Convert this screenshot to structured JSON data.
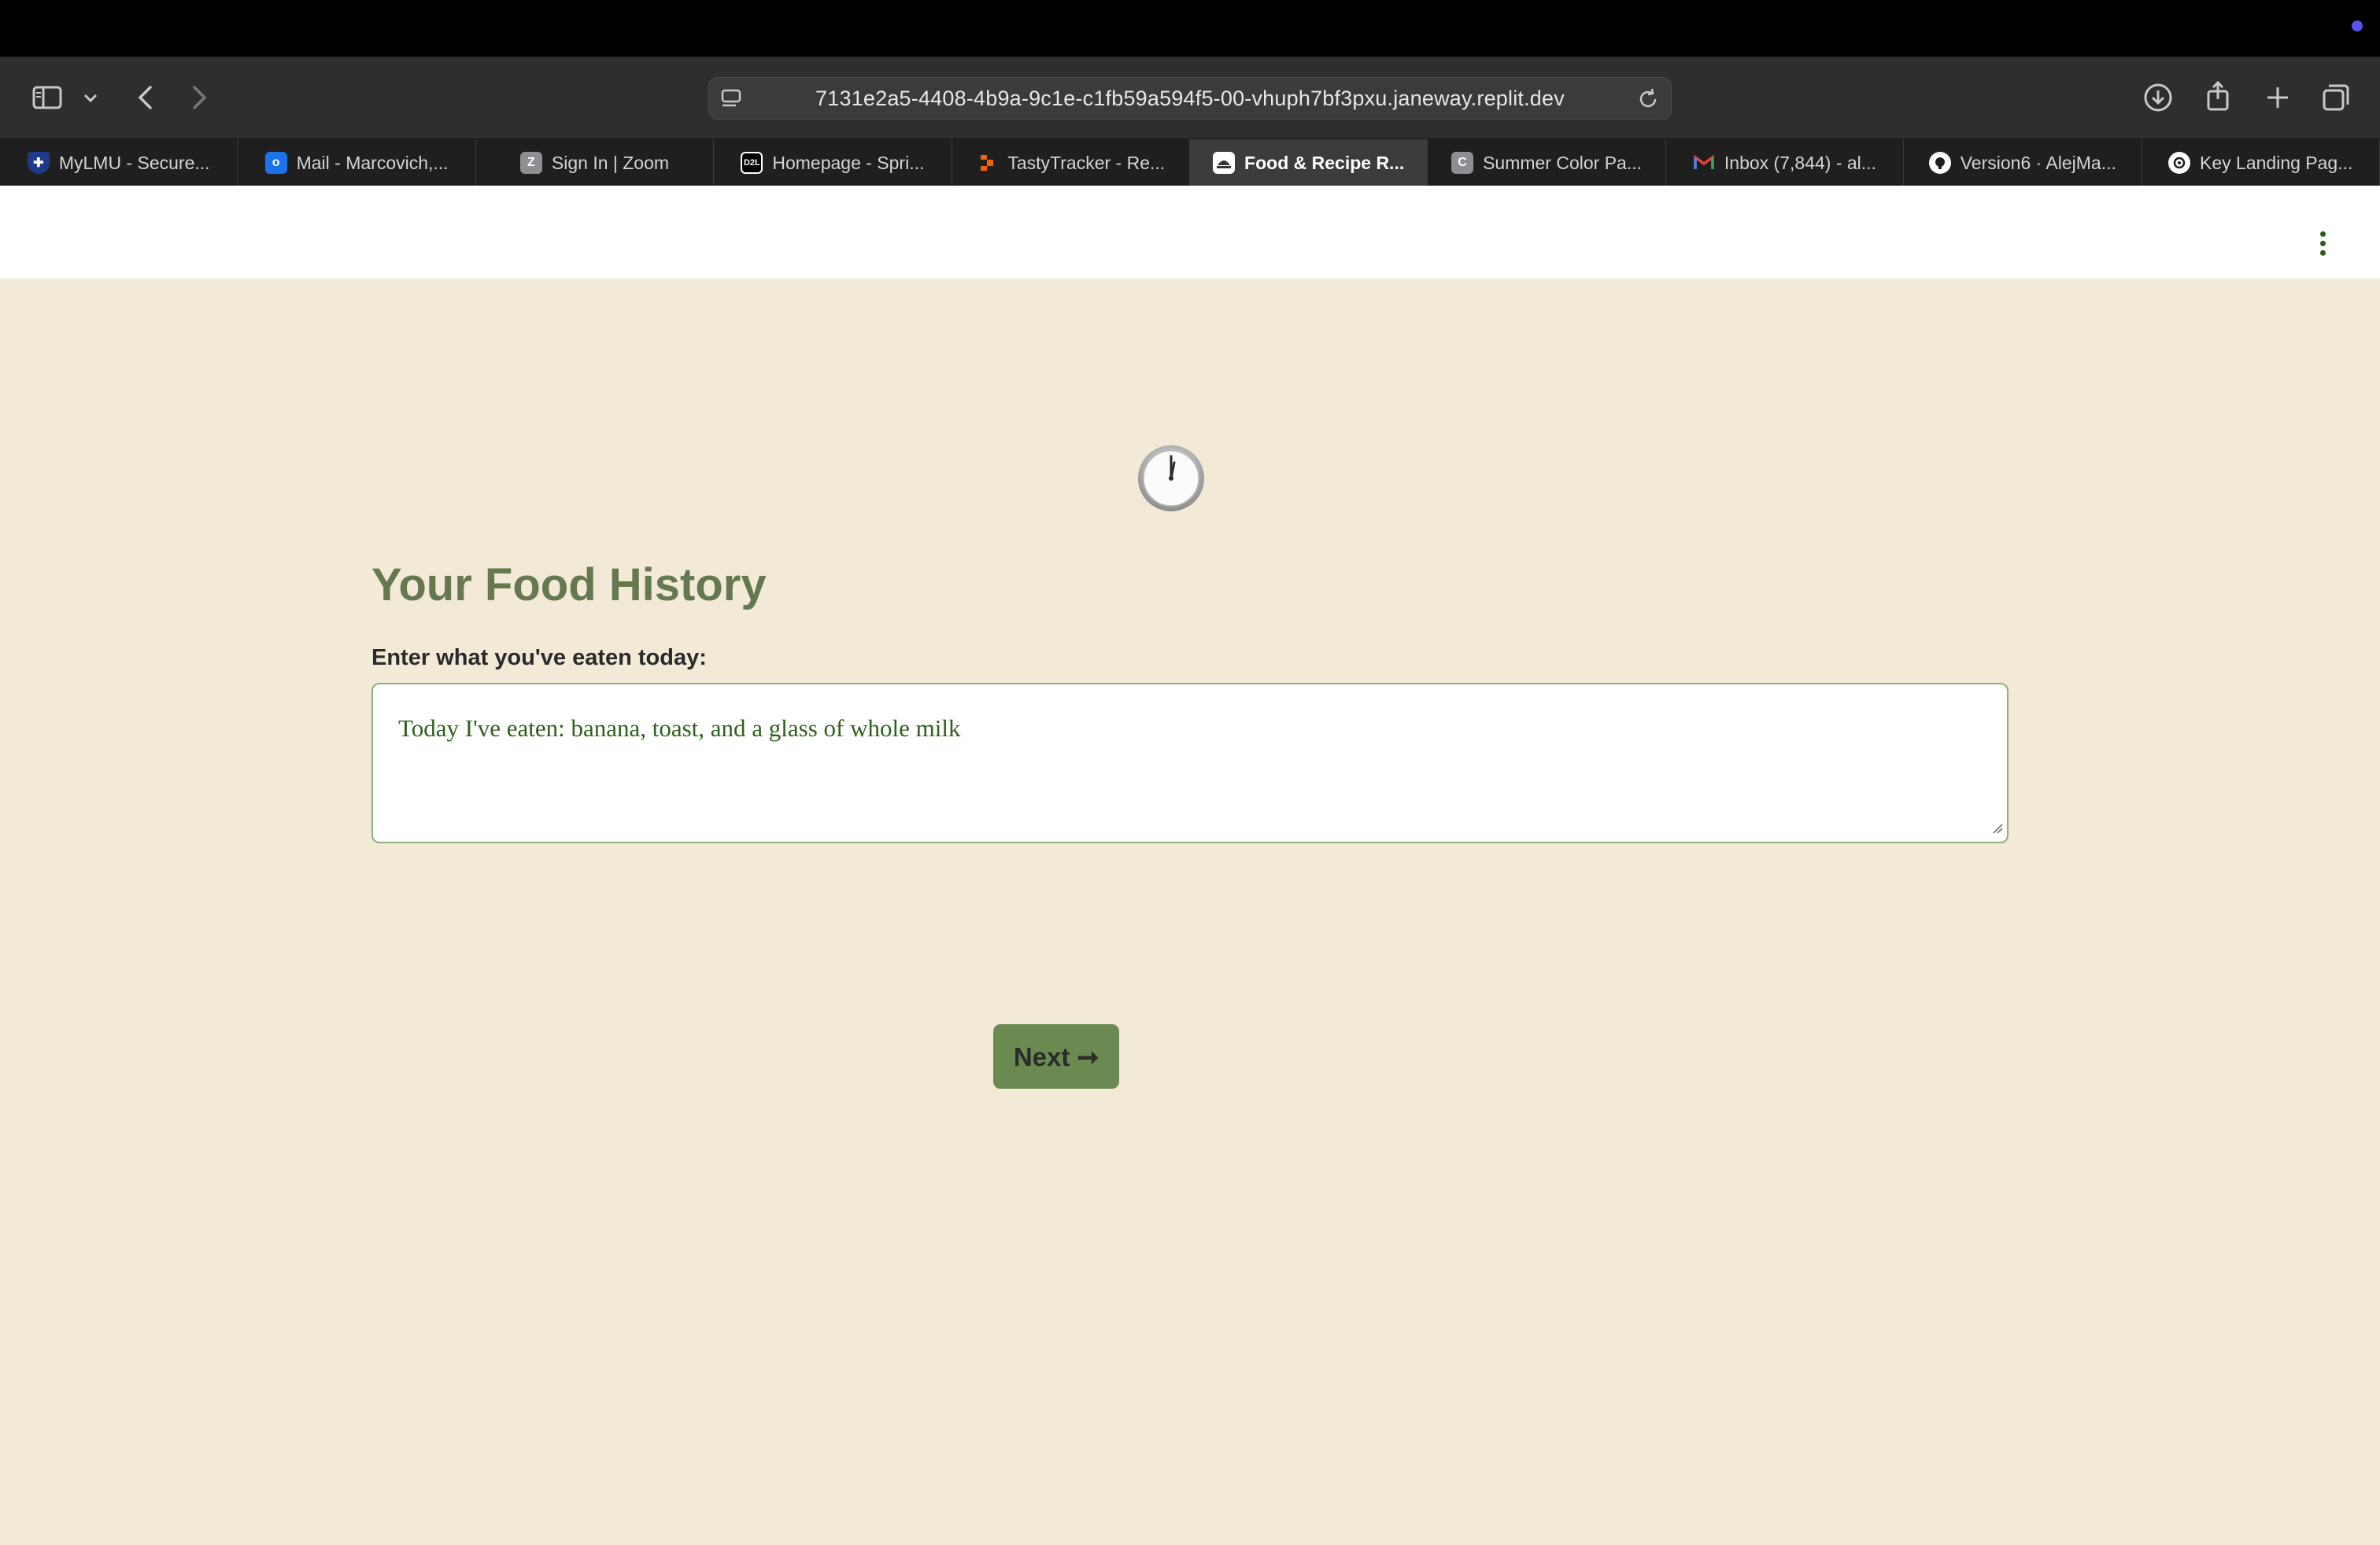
{
  "browser": {
    "url": "7131e2a5-4408-4b9a-9c1e-c1fb59a594f5-00-vhuph7bf3pxu.janeway.replit.dev",
    "tabs": [
      {
        "label": "MyLMU - Secure...",
        "icon": "shield-icon",
        "color": "#1e3a8a"
      },
      {
        "label": "Mail - Marcovich,...",
        "icon": "outlook-icon",
        "color": "#1a73e8"
      },
      {
        "label": "Sign In | Zoom",
        "icon": "zoom-icon",
        "color": "#8e8e93",
        "glyph": "Z"
      },
      {
        "label": "Homepage - Spri...",
        "icon": "d2l-icon",
        "color": "#000000",
        "glyph": "D2L"
      },
      {
        "label": "TastyTracker - Re...",
        "icon": "replit-icon",
        "color": "#f26207"
      },
      {
        "label": "Food & Recipe R...",
        "icon": "recipe-icon",
        "color": "#ffffff",
        "active": true
      },
      {
        "label": "Summer Color Pa...",
        "icon": "coolors-icon",
        "color": "#8e8e93",
        "glyph": "C"
      },
      {
        "label": "Inbox (7,844) - al...",
        "icon": "gmail-icon",
        "color": "#ea4335"
      },
      {
        "label": "Version6 · AlejMa...",
        "icon": "github-icon",
        "color": "#ffffff"
      },
      {
        "label": "Key Landing Pag...",
        "icon": "openai-icon",
        "color": "#ffffff"
      }
    ]
  },
  "page": {
    "title": "Your Food History",
    "input_label": "Enter what you've eaten today:",
    "food_entry": "Today I've eaten: banana, toast, and a glass of whole milk",
    "next_label": "Next ➞"
  },
  "colors": {
    "background": "#f2ead6",
    "title": "#667850",
    "button": "#6b8a52",
    "input_border": "#8fb07a"
  }
}
